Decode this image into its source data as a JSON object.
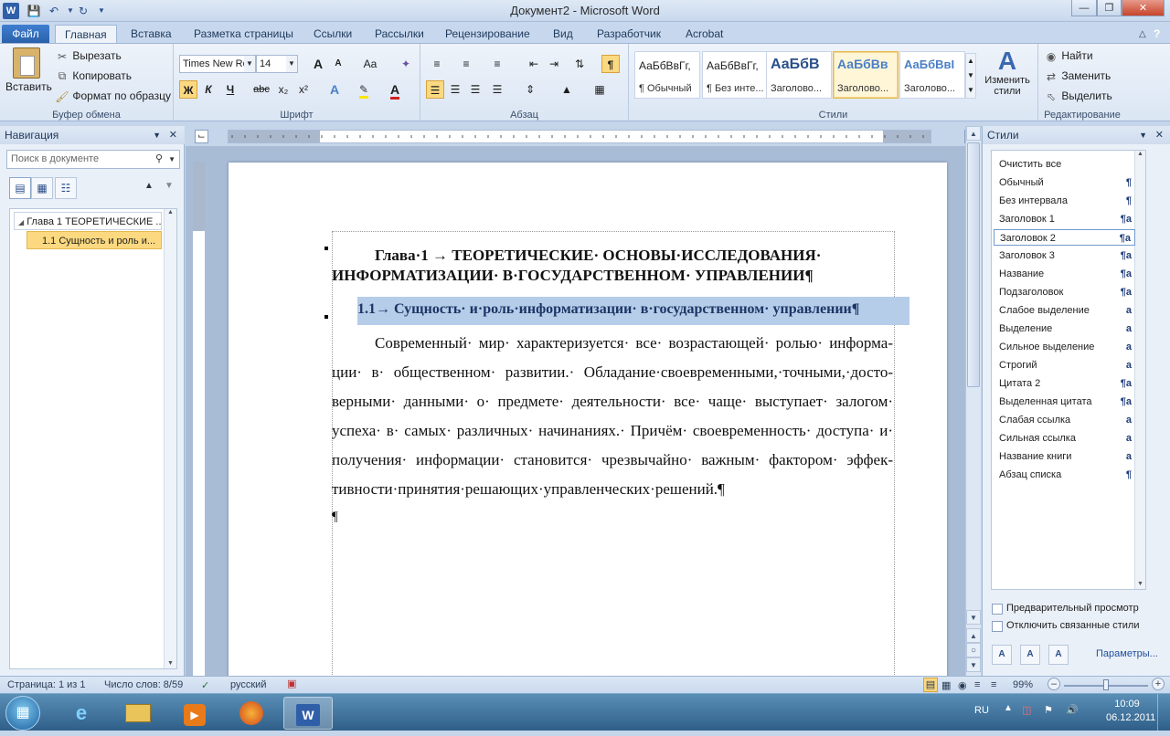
{
  "window": {
    "title": "Документ2  -  Microsoft Word",
    "app_icon": "W",
    "qat": [
      "save-icon",
      "undo-icon",
      "redo-icon",
      "customize-icon"
    ]
  },
  "tabs": [
    "Файл",
    "Главная",
    "Вставка",
    "Разметка страницы",
    "Ссылки",
    "Рассылки",
    "Рецензирование",
    "Вид",
    "Разработчик",
    "Acrobat"
  ],
  "ribbon": {
    "clipboard": {
      "paste": "Вставить",
      "cut": "Вырезать",
      "copy": "Копировать",
      "format_painter": "Формат по образцу",
      "label": "Буфер обмена"
    },
    "font": {
      "name": "Times New Ro",
      "size": "14",
      "grow": "A",
      "shrink": "A",
      "case": "Aa",
      "bold": "Ж",
      "italic": "К",
      "underline": "Ч",
      "strike": "abc",
      "sub": "x₂",
      "sup": "x²",
      "label": "Шрифт"
    },
    "paragraph": {
      "label": "Абзац",
      "pilcrow": "¶"
    },
    "styles": {
      "label": "Стили",
      "items": [
        {
          "sample": "АаБбВвГг,",
          "name": "¶ Обычный"
        },
        {
          "sample": "АаБбВвГг,",
          "name": "¶ Без инте..."
        },
        {
          "sample": "АаБбВ",
          "name": "Заголово..."
        },
        {
          "sample": "АаБбВв",
          "name": "Заголово..."
        },
        {
          "sample": "АаБбВвІ",
          "name": "Заголово..."
        }
      ],
      "change": "Изменить",
      "change2": "стили"
    },
    "editing": {
      "label": "Редактирование",
      "find": "Найти",
      "replace": "Заменить",
      "select": "Выделить"
    }
  },
  "nav": {
    "title": "Навигация",
    "search_placeholder": "Поиск в документе",
    "items": [
      "Глава 1 ТЕОРЕТИЧЕСКИЕ ...",
      "1.1 Сущность и роль и..."
    ]
  },
  "document": {
    "heading1_line1": "Глава·1 → ТЕОРЕТИЧЕСКИЕ· ОСНОВЫ·ИССЛЕДОВАНИЯ·",
    "heading1_line2": "ИНФОРМАТИЗАЦИИ· В·ГОСУДАРСТВЕННОМ· УПРАВЛЕНИИ¶",
    "heading2": "1.1→ Сущность· и·роль·информатизации· в·государственном· управлении¶",
    "body": [
      "Современный· мир· характеризуется· все· возрастающей· ролью· информа-",
      "ции· в· общественном· развитии.· Обладание·своевременными,·точными,·досто-",
      "верными· данными· о· предмете· деятельности· все· чаще· выступает· залогом·",
      "успеха· в· самых· различных· начинаниях.· Причём· своевременность· доступа· и·",
      "получения· информации· становится· чрезвычайно· важным· фактором· эффек-",
      "тивности·принятия·решающих·управленческих·решений.¶"
    ],
    "empty_para": "¶"
  },
  "styles_pane": {
    "title": "Стили",
    "items": [
      {
        "name": "Очистить все",
        "mark": ""
      },
      {
        "name": "Обычный",
        "mark": "¶"
      },
      {
        "name": "Без интервала",
        "mark": "¶"
      },
      {
        "name": "Заголовок 1",
        "mark": "¶a"
      },
      {
        "name": "Заголовок 2",
        "mark": "¶a"
      },
      {
        "name": "Заголовок 3",
        "mark": "¶a"
      },
      {
        "name": "Название",
        "mark": "¶a"
      },
      {
        "name": "Подзаголовок",
        "mark": "¶a"
      },
      {
        "name": "Слабое выделение",
        "mark": "a"
      },
      {
        "name": "Выделение",
        "mark": "a"
      },
      {
        "name": "Сильное выделение",
        "mark": "a"
      },
      {
        "name": "Строгий",
        "mark": "a"
      },
      {
        "name": "Цитата 2",
        "mark": "¶a"
      },
      {
        "name": "Выделенная цитата",
        "mark": "¶a"
      },
      {
        "name": "Слабая ссылка",
        "mark": "a"
      },
      {
        "name": "Сильная ссылка",
        "mark": "a"
      },
      {
        "name": "Название книги",
        "mark": "a"
      },
      {
        "name": "Абзац списка",
        "mark": "¶"
      }
    ],
    "selected_index": 4,
    "preview": "Предварительный просмотр",
    "disable_linked": "Отключить связанные стили",
    "options": "Параметры..."
  },
  "status": {
    "page": "Страница: 1 из 1",
    "words": "Число слов: 8/59",
    "lang": "русский",
    "zoom": "99%"
  },
  "taskbar": {
    "lang": "RU",
    "time": "10:09",
    "date": "06.12.2011"
  }
}
